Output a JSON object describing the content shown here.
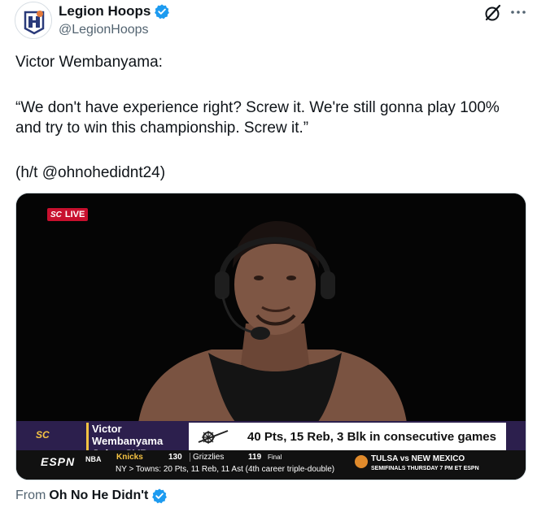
{
  "author": {
    "display_name": "Legion Hoops",
    "handle": "@LegionHoops",
    "avatar": "legion-hoops-logo",
    "verified": true
  },
  "header_actions": {
    "grok_icon": "grok-icon",
    "more_icon": "more-icon"
  },
  "tweet": {
    "line1": "Victor Wembanyama:",
    "quote": "“We don't have experience right? Screw it. We're still gonna play 100% and try to win this championship. Screw it.”",
    "credit": "(h/t @ohnohedidnt24)"
  },
  "video": {
    "live_badge": {
      "network": "SC",
      "label": "LIVE"
    },
    "chyron": {
      "name": "Victor Wembanyama",
      "subtitle": "Joins SVP",
      "stat": "40 Pts, 15 Reb, 3 Blk in consecutive games"
    },
    "ticker": {
      "network": "ESPN",
      "league": "NBA",
      "team1": "Knicks",
      "score1": "130",
      "team2": "Grizzlies",
      "score2": "119",
      "status": "Final",
      "line": "NY  >  Towns: 20 Pts, 11 Reb, 11 Ast (4th career triple-double)",
      "promo_title": "TULSA vs NEW MEXICO",
      "promo_sub": "SEMIFINALS THURSDAY 7 PM ET ESPN"
    }
  },
  "source": {
    "prefix": "From",
    "name": "Oh No He Didn't",
    "verified": true
  },
  "colors": {
    "verified_blue": "#1d9bf0",
    "text_primary": "#0f1419",
    "text_secondary": "#536471",
    "chyron_purple": "#2c1f4d",
    "chyron_gold": "#f6c343",
    "live_red": "#c8102e"
  }
}
